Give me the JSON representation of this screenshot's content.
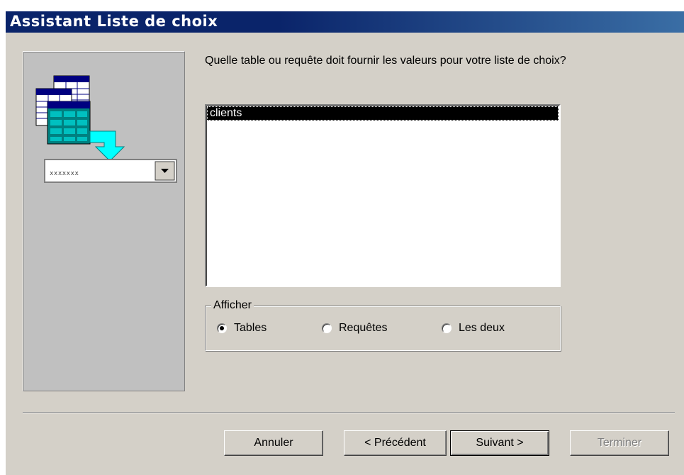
{
  "window": {
    "title": "Assistant Liste de choix"
  },
  "illustration": {
    "combo_text": "xxxxxxx"
  },
  "prompt": "Quelle table ou requête doit fournir les valeurs pour votre liste de choix?",
  "list": {
    "items": [
      "clients"
    ],
    "selected_index": 0
  },
  "display_group": {
    "legend": "Afficher",
    "options": [
      {
        "label": "Tables",
        "checked": true
      },
      {
        "label": "Requêtes",
        "checked": false
      },
      {
        "label": "Les deux",
        "checked": false
      }
    ]
  },
  "buttons": {
    "cancel": "Annuler",
    "previous": "< Précédent",
    "next": "Suivant >",
    "finish": "Terminer"
  }
}
